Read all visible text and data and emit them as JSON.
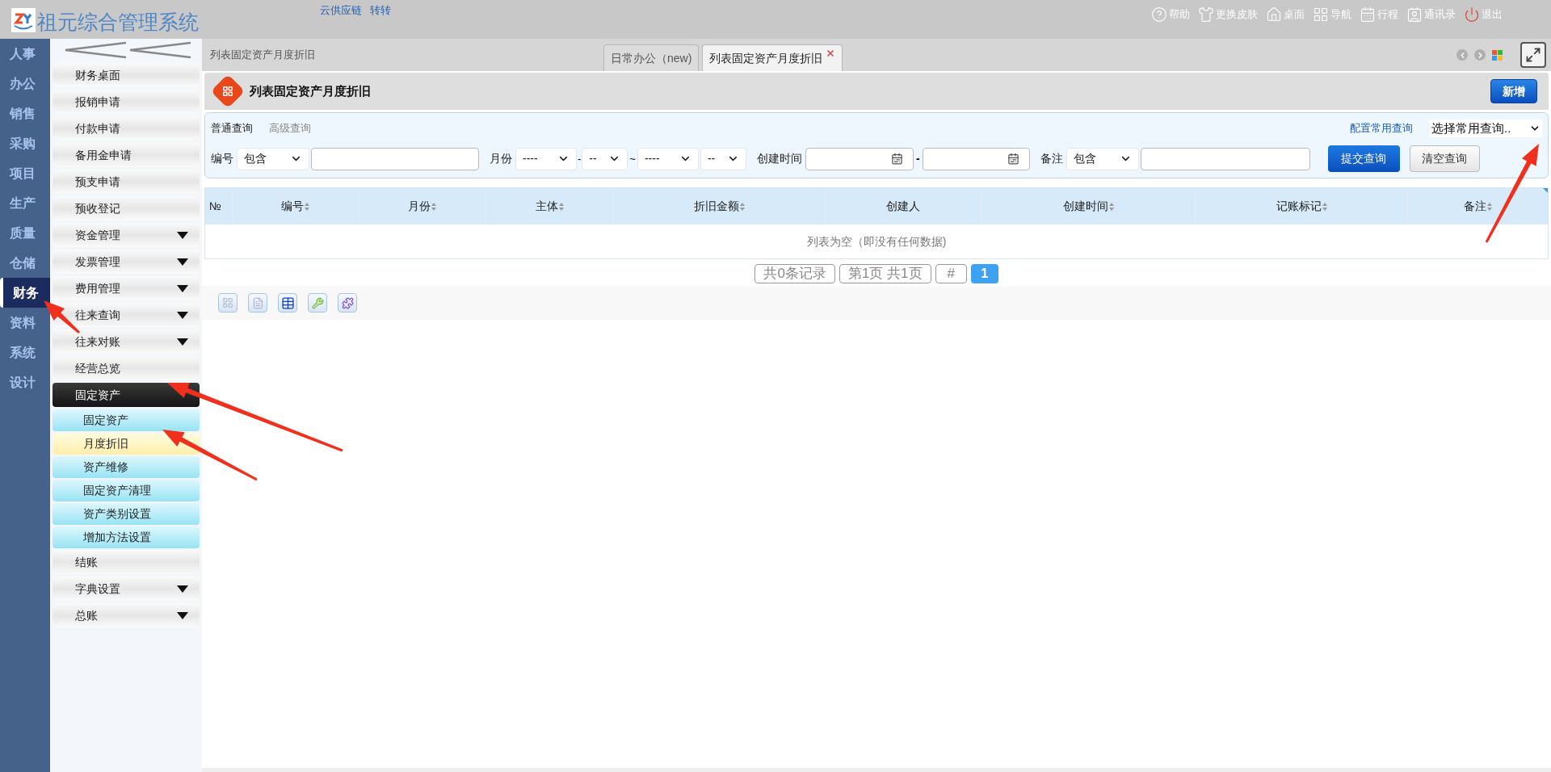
{
  "header": {
    "title": "祖元综合管理系统",
    "links": [
      "云供应链",
      "转转"
    ],
    "actions": [
      {
        "label": "帮助",
        "kind": "normal"
      },
      {
        "label": "更换皮肤",
        "kind": "normal"
      },
      {
        "label": "桌面",
        "kind": "normal"
      },
      {
        "label": "导航",
        "kind": "normal"
      },
      {
        "label": "行程",
        "kind": "normal"
      },
      {
        "label": "通讯录",
        "kind": "normal"
      },
      {
        "label": "退出",
        "kind": "exit"
      }
    ]
  },
  "modules": [
    {
      "label": "人事",
      "selected": false
    },
    {
      "label": "办公",
      "selected": false
    },
    {
      "label": "销售",
      "selected": false
    },
    {
      "label": "采购",
      "selected": false
    },
    {
      "label": "项目",
      "selected": false
    },
    {
      "label": "生产",
      "selected": false
    },
    {
      "label": "质量",
      "selected": false
    },
    {
      "label": "仓储",
      "selected": false
    },
    {
      "label": "财务",
      "selected": true
    },
    {
      "label": "资料",
      "selected": false
    },
    {
      "label": "系统",
      "selected": false
    },
    {
      "label": "设计",
      "selected": false
    }
  ],
  "menu": [
    {
      "label": "财务桌面",
      "kind": "item"
    },
    {
      "label": "报销申请",
      "kind": "item"
    },
    {
      "label": "付款申请",
      "kind": "item"
    },
    {
      "label": "备用金申请",
      "kind": "item"
    },
    {
      "label": "预支申请",
      "kind": "item"
    },
    {
      "label": "预收登记",
      "kind": "item"
    },
    {
      "label": "资金管理",
      "kind": "group",
      "expanded": false
    },
    {
      "label": "发票管理",
      "kind": "group",
      "expanded": false
    },
    {
      "label": "费用管理",
      "kind": "group",
      "expanded": false
    },
    {
      "label": "往来查询",
      "kind": "group",
      "expanded": false
    },
    {
      "label": "往来对账",
      "kind": "group",
      "expanded": false
    },
    {
      "label": "经营总览",
      "kind": "item"
    },
    {
      "label": "固定资产",
      "kind": "group",
      "expanded": true,
      "children": [
        {
          "label": "固定资产",
          "selected": false
        },
        {
          "label": "月度折旧",
          "selected": true
        },
        {
          "label": "资产维修",
          "selected": false
        },
        {
          "label": "固定资产清理",
          "selected": false
        },
        {
          "label": "资产类别设置",
          "selected": false
        },
        {
          "label": "增加方法设置",
          "selected": false
        }
      ]
    },
    {
      "label": "结账",
      "kind": "item"
    },
    {
      "label": "字典设置",
      "kind": "group",
      "expanded": false
    },
    {
      "label": "总账",
      "kind": "group",
      "expanded": false
    }
  ],
  "breadcrumb": "列表固定资产月度折旧",
  "tabs": [
    {
      "label": "日常办公（new)",
      "selected": false,
      "closable": false
    },
    {
      "label": "列表固定资产月度折旧",
      "selected": true,
      "closable": true
    }
  ],
  "page_title": "列表固定资产月度折旧",
  "add_button": "新增",
  "query": {
    "modes": [
      {
        "label": "普通查询",
        "selected": true
      },
      {
        "label": "高级查询",
        "selected": false
      }
    ],
    "config_link": "配置常用查询",
    "saved_query": "选择常用查询..",
    "filters": [
      {
        "kind": "text",
        "label": "编号",
        "operator": "包含"
      },
      {
        "kind": "month_range",
        "label": "月份",
        "from_year": "----",
        "dash": "-",
        "from_month": "--",
        "tilde": "~",
        "to_year": "----",
        "to_month": "--"
      },
      {
        "kind": "date_range",
        "label": "创建时间",
        "dash": "-"
      },
      {
        "kind": "text",
        "label": "备注",
        "operator": "包含"
      }
    ],
    "submit": "提交查询",
    "clear": "清空查询"
  },
  "table": {
    "columns": [
      {
        "label": "№",
        "sortable": false
      },
      {
        "label": "编号",
        "sortable": true
      },
      {
        "label": "月份",
        "sortable": true
      },
      {
        "label": "主体",
        "sortable": true
      },
      {
        "label": "折旧金额",
        "sortable": true
      },
      {
        "label": "创建人",
        "sortable": false
      },
      {
        "label": "创建时间",
        "sortable": true
      },
      {
        "label": "记账标记",
        "sortable": true
      },
      {
        "label": "备注",
        "sortable": true
      }
    ],
    "empty_message": "列表为空（即没有任何数据)"
  },
  "pagination": {
    "summary": "共0条记录",
    "page_info": "第1页 共1页",
    "jump": "#",
    "pages": [
      {
        "label": "1",
        "selected": true
      }
    ]
  }
}
